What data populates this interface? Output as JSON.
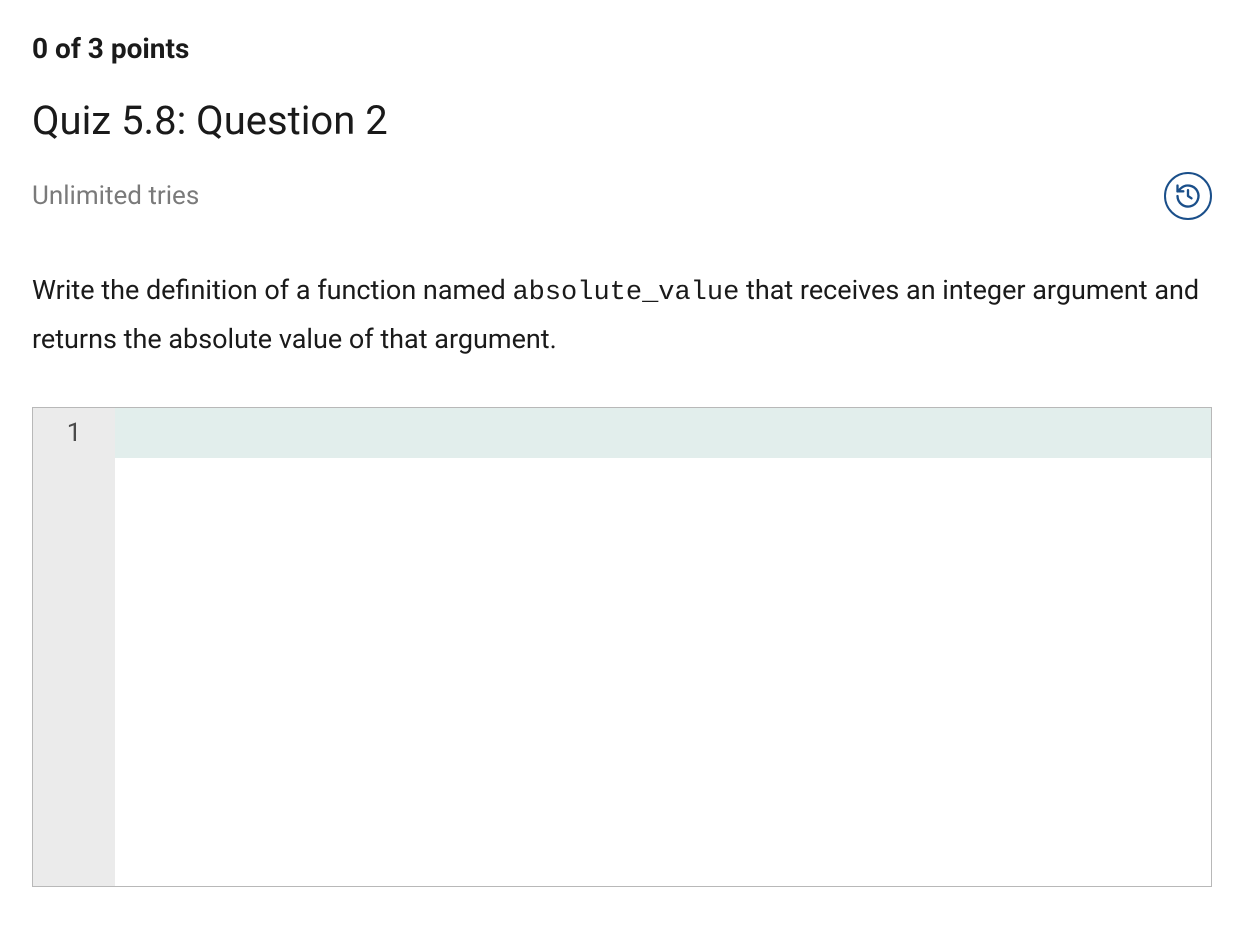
{
  "points": {
    "earned": 0,
    "total": 3,
    "label": "0 of 3 points"
  },
  "question": {
    "title": "Quiz 5.8: Question 2",
    "tries_label": "Unlimited tries",
    "instructions_prefix": "Write the definition of a function named ",
    "function_name": "absolute_value",
    "instructions_suffix": " that receives an integer argument and returns the absolute value of that argument."
  },
  "editor": {
    "line_numbers": [
      "1"
    ],
    "content": "",
    "active_line": 1
  },
  "icons": {
    "history": "history-icon"
  }
}
